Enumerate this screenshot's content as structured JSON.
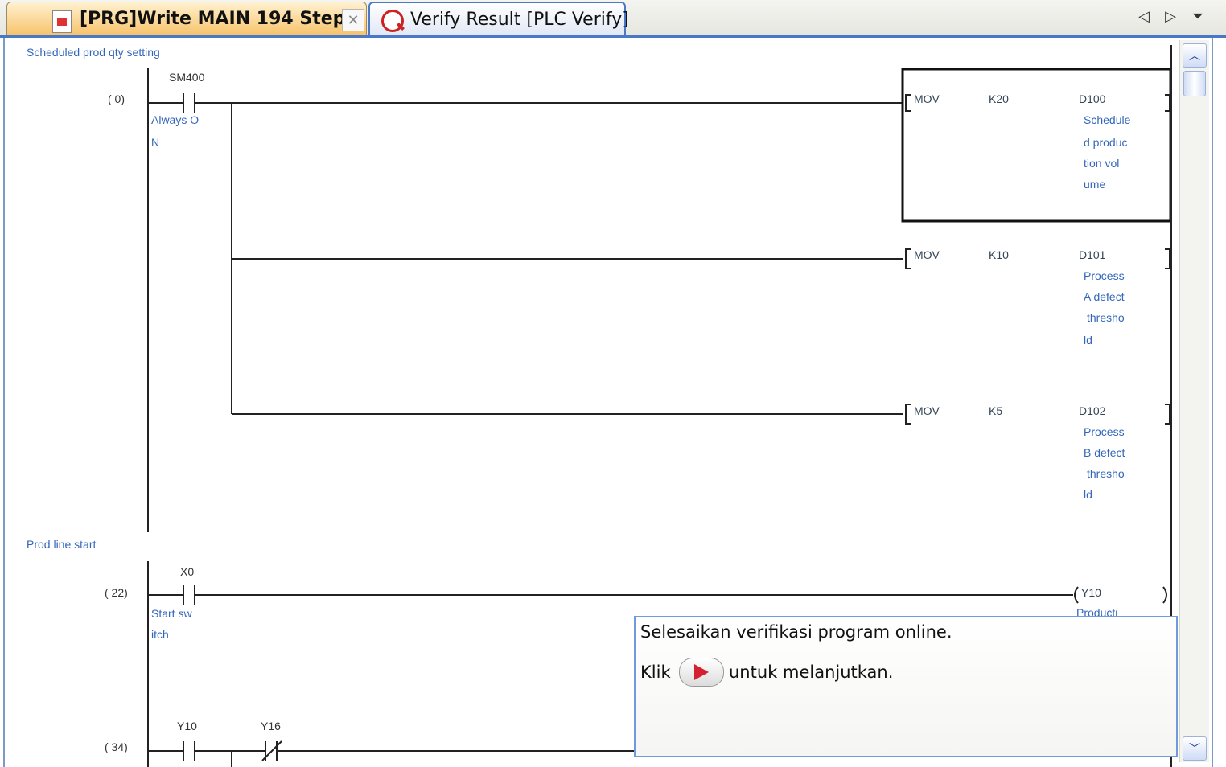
{
  "tabs": [
    {
      "label": "[PRG]Write MAIN 194 Step",
      "icon": "program-doc-icon",
      "close_icon": "✕"
    },
    {
      "label": "Verify Result [PLC Verify]",
      "icon": "verify-magnifier-icon"
    }
  ],
  "nav": {
    "prev": "◁",
    "next": "▷",
    "menu": "⏷"
  },
  "scroll": {
    "up": "︿",
    "down": "﹀"
  },
  "ladder": {
    "block1": {
      "comment": "Scheduled prod qty setting",
      "step": "(    0)",
      "contact": {
        "device": "SM400",
        "comment_lines": [
          "Always O",
          "N"
        ]
      },
      "rows": [
        {
          "instr": "MOV",
          "src": "K20",
          "dest": "D100",
          "comment_lines": [
            "Schedule",
            "d produc",
            "tion vol",
            "ume"
          ]
        },
        {
          "instr": "MOV",
          "src": "K10",
          "dest": "D101",
          "comment_lines": [
            "Process",
            "A defect",
            "thresho",
            "ld"
          ]
        },
        {
          "instr": "MOV",
          "src": "K5",
          "dest": "D102",
          "comment_lines": [
            "Process",
            "B defect",
            "thresho",
            "ld"
          ]
        }
      ]
    },
    "block2": {
      "comment": "Prod line start",
      "step": "(   22)",
      "contact": {
        "device": "X0",
        "comment_lines": [
          "Start sw",
          "itch"
        ]
      },
      "coil": {
        "device": "Y10",
        "comment_partial": "Producti"
      }
    },
    "block3": {
      "step": "(   34)",
      "contact1": "Y10",
      "contact2": "Y16"
    }
  },
  "popup": {
    "line1": "Selesaikan verifikasi program online.",
    "line2_before": "Klik",
    "line2_after": "untuk melanjutkan.",
    "button_icon": "play-icon"
  },
  "colors": {
    "accent": "#4a78c8",
    "active_tab": "#f6bf62",
    "comment_text": "#3366bb",
    "play": "#d42030"
  }
}
